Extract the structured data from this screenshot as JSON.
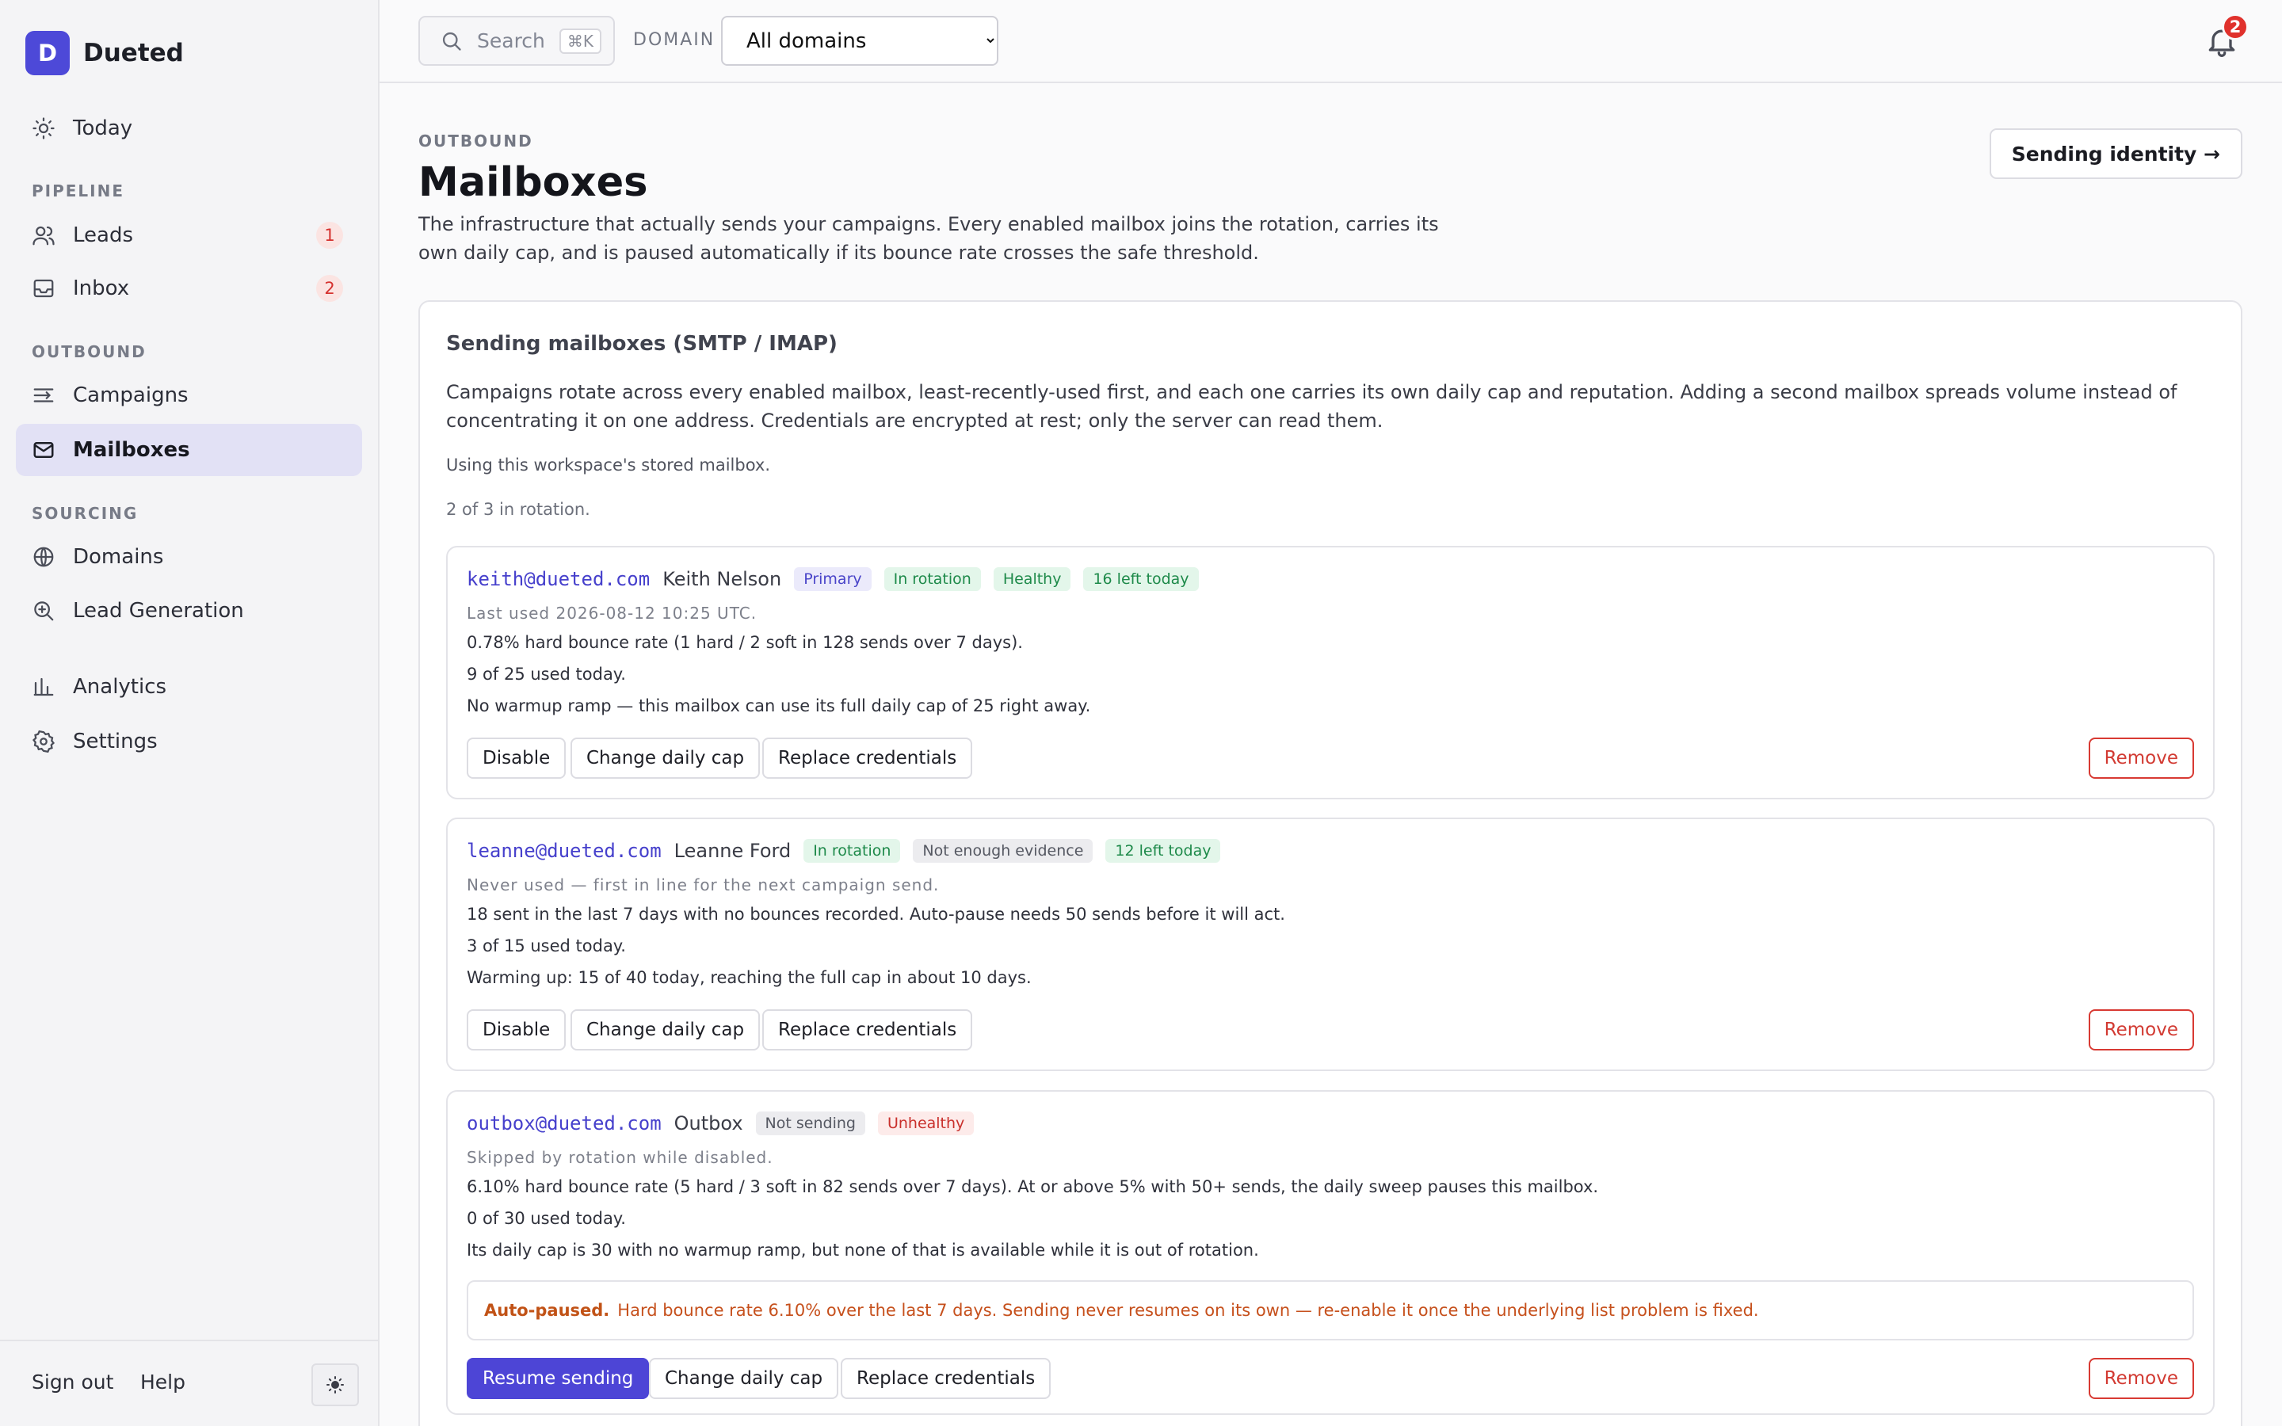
{
  "brand": {
    "logo_letter": "D",
    "name": "Dueted"
  },
  "sidebar": {
    "today": "Today",
    "sections": {
      "pipeline": "PIPELINE",
      "outbound": "OUTBOUND",
      "sourcing": "SOURCING"
    },
    "items": {
      "leads": {
        "label": "Leads",
        "badge": "1"
      },
      "inbox": {
        "label": "Inbox",
        "badge": "2"
      },
      "campaigns": {
        "label": "Campaigns"
      },
      "mailboxes": {
        "label": "Mailboxes"
      },
      "domains": {
        "label": "Domains"
      },
      "lead_generation": {
        "label": "Lead Generation"
      },
      "analytics": {
        "label": "Analytics"
      },
      "settings": {
        "label": "Settings"
      }
    },
    "footer": {
      "sign_out": "Sign out",
      "help": "Help"
    }
  },
  "topbar": {
    "search_placeholder": "Search",
    "search_shortcut": "⌘K",
    "domain_label": "DOMAIN",
    "domain_selected": "All domains",
    "notifications_count": "2"
  },
  "page": {
    "eyebrow": "OUTBOUND",
    "title": "Mailboxes",
    "description": "The infrastructure that actually sends your campaigns. Every enabled mailbox joins the rotation, carries its own daily cap, and is paused automatically if its bounce rate crosses the safe threshold.",
    "identity_button": "Sending identity →"
  },
  "card": {
    "title": "Sending mailboxes (SMTP / IMAP)",
    "description": "Campaigns rotate across every enabled mailbox, least-recently-used first, and each one carries its own daily cap and reputation. Adding a second mailbox spreads volume instead of concentrating it on one address. Credentials are encrypted at rest; only the server can read them.",
    "stored_note": "Using this workspace's stored mailbox.",
    "rotation_note": "2 of 3 in rotation."
  },
  "buttons": {
    "disable": "Disable",
    "change_cap": "Change daily cap",
    "replace": "Replace credentials",
    "remove": "Remove",
    "resume": "Resume sending"
  },
  "mailboxes": [
    {
      "email": "keith@dueted.com",
      "name": "Keith Nelson",
      "badges": [
        "Primary",
        "In rotation",
        "Healthy",
        "16 left today"
      ],
      "last_used": "Last used 2026-08-12 10:25 UTC.",
      "lines": [
        "0.78% hard bounce rate (1 hard / 2 soft in 128 sends over 7 days).",
        "9 of 25 used today.",
        "No warmup ramp — this mailbox can use its full daily cap of 25 right away."
      ]
    },
    {
      "email": "leanne@dueted.com",
      "name": "Leanne Ford",
      "badges": [
        "In rotation",
        "Not enough evidence",
        "12 left today"
      ],
      "last_used": "Never used — first in line for the next campaign send.",
      "lines": [
        "18 sent in the last 7 days with no bounces recorded. Auto-pause needs 50 sends before it will act.",
        "3 of 15 used today.",
        "Warming up: 15 of 40 today, reaching the full cap in about 10 days."
      ]
    },
    {
      "email": "outbox@dueted.com",
      "name": "Outbox",
      "badges": [
        "Not sending",
        "Unhealthy"
      ],
      "last_used": "Skipped by rotation while disabled.",
      "lines": [
        "6.10% hard bounce rate (5 hard / 3 soft in 82 sends over 7 days). At or above 5% with 50+ sends, the daily sweep pauses this mailbox.",
        "0 of 30 used today.",
        "Its daily cap is 30 with no warmup ramp, but none of that is available while it is out of rotation."
      ],
      "alert_title": "Auto-paused.",
      "alert_text": "Hard bounce rate 6.10% over the last 7 days. Sending never resumes on its own — re-enable it once the underlying list problem is fixed."
    }
  ],
  "colors": {
    "accent": "#4d45d6",
    "danger": "#d23a32",
    "success": "#1e8a4a",
    "warning": "#c15216"
  }
}
